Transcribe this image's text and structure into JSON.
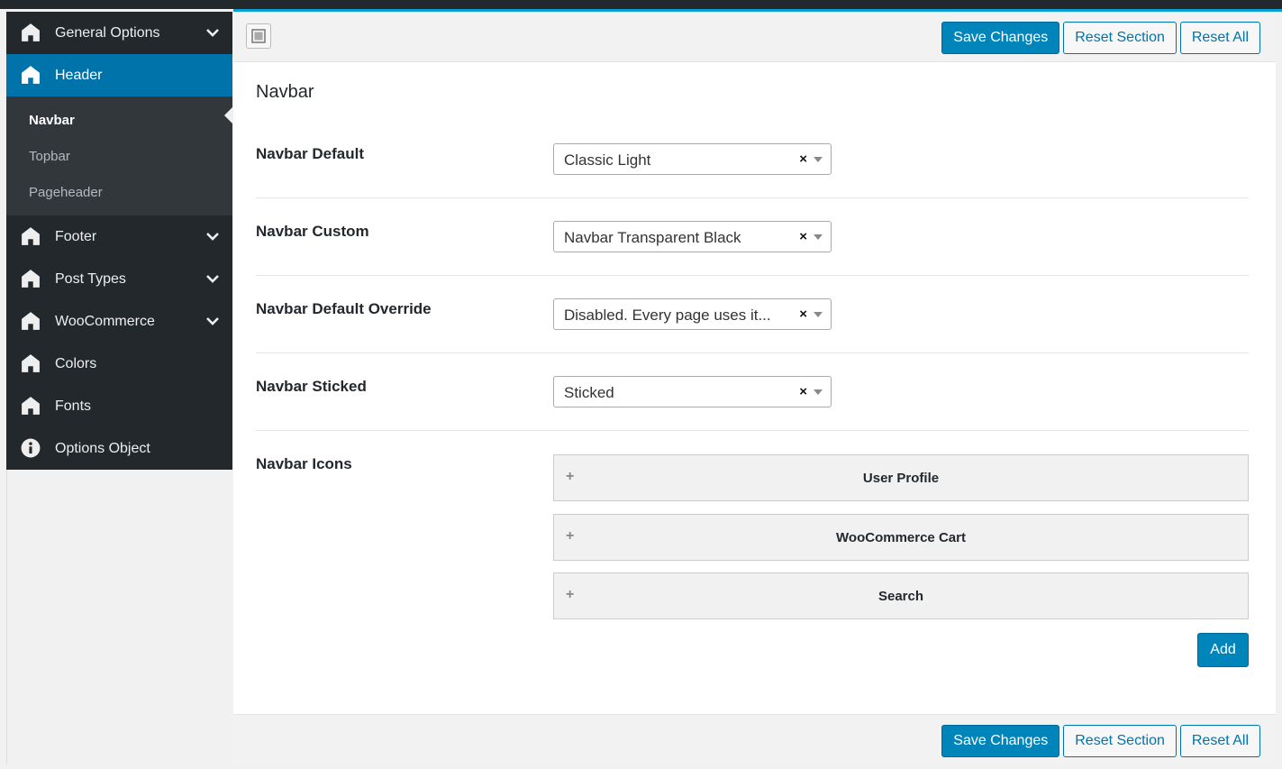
{
  "sidebar": {
    "items": [
      {
        "label": "General Options",
        "icon": "home-icon",
        "has_chevron": true
      },
      {
        "label": "Header",
        "icon": "home-icon",
        "active": true
      },
      {
        "label": "Footer",
        "icon": "home-icon",
        "has_chevron": true
      },
      {
        "label": "Post Types",
        "icon": "home-icon",
        "has_chevron": true
      },
      {
        "label": "WooCommerce",
        "icon": "home-icon",
        "has_chevron": true
      },
      {
        "label": "Colors",
        "icon": "home-icon"
      },
      {
        "label": "Fonts",
        "icon": "home-icon"
      },
      {
        "label": "Options Object",
        "icon": "info-icon"
      }
    ],
    "submenu": [
      "Navbar",
      "Topbar",
      "Pageheader"
    ],
    "current_sub": "Navbar"
  },
  "toolbar": {
    "save_label": "Save Changes",
    "reset_section_label": "Reset Section",
    "reset_all_label": "Reset All"
  },
  "section": {
    "title": "Navbar",
    "fields": [
      {
        "label": "Navbar Default",
        "value": "Classic Light"
      },
      {
        "label": "Navbar Custom",
        "value": "Navbar Transparent Black"
      },
      {
        "label": "Navbar Default Override",
        "value": "Disabled. Every page uses it..."
      },
      {
        "label": "Navbar Sticked",
        "value": "Sticked"
      }
    ],
    "icons_label": "Navbar Icons",
    "icons": [
      "User Profile",
      "WooCommerce Cart",
      "Search"
    ],
    "add_label": "Add",
    "clear_glyph": "×",
    "plus_glyph": "+"
  },
  "colors": {
    "accent": "#0073aa",
    "primary_button": "#0085ba",
    "sidebar_bg": "#23282d",
    "submenu_bg": "#32373c"
  }
}
